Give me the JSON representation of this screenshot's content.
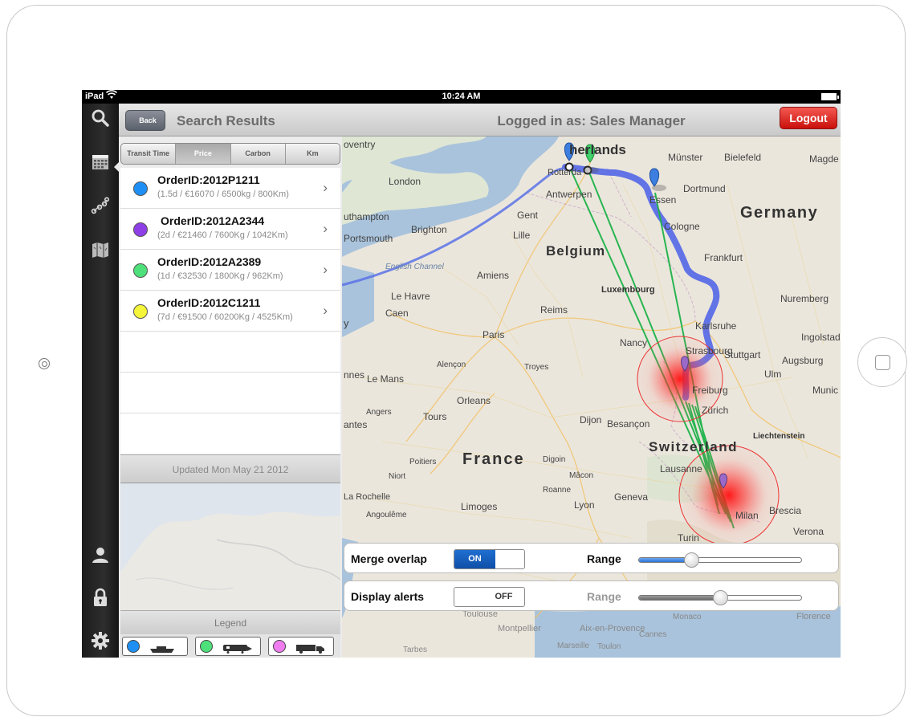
{
  "status_bar": {
    "carrier": "iPad",
    "time": "10:24 AM"
  },
  "toolbar": {
    "icons": [
      "search-icon",
      "calendar-icon",
      "route-icon",
      "map-icon",
      "user-icon",
      "lock-icon",
      "gear-icon"
    ]
  },
  "left_panel": {
    "back_label": "Back",
    "title": "Search Results",
    "segments": [
      {
        "label": "Transit Time",
        "active": false
      },
      {
        "label": "Price",
        "active": true
      },
      {
        "label": "Carbon",
        "active": false
      },
      {
        "label": "Km",
        "active": false
      }
    ],
    "orders": [
      {
        "id": "OrderID:2012P1211",
        "details": "(1.5d / €16070 / 6500kg / 800Km)",
        "color": "#1e90f5"
      },
      {
        "id": "OrderID:2012A2344",
        "details": "(2d / €21460 / 7600Kg / 1042Km)",
        "color": "#8e3fe6"
      },
      {
        "id": "OrderID:2012A2389",
        "details": "(1d / €32530 / 1800Kg / 962Km)",
        "color": "#4ee07a"
      },
      {
        "id": "OrderID:2012C1211",
        "details": "(7d / €91500 / 60200Kg / 4525Km)",
        "color": "#f5f53a"
      }
    ],
    "updated": "Updated Mon May 21 2012",
    "legend_title": "Legend",
    "legend": [
      {
        "color": "#1e90f5",
        "vehicle": "ship-icon"
      },
      {
        "color": "#4ee07a",
        "vehicle": "train-icon"
      },
      {
        "color": "#f07df0",
        "vehicle": "truck-icon"
      }
    ]
  },
  "map_header": {
    "title": "Logged in as: Sales Manager",
    "logout": "Logout"
  },
  "map_labels": {
    "country_germany": "Germany",
    "country_belgium": "Belgium",
    "country_france": "France",
    "country_switzerland": "Switzerland",
    "country_netherlands": "herlands",
    "london": "London",
    "rotterdam": "Rotterda",
    "antwerpen": "Antwerpen",
    "gent": "Gent",
    "lille": "Lille",
    "brighton": "Brighton",
    "portsmouth": "Portsmouth",
    "southampton": "uthampton",
    "english_channel": "English Channel",
    "amiens": "Amiens",
    "le_havre": "Le Havre",
    "caen": "Caen",
    "reims": "Reims",
    "paris": "Paris",
    "luxembourg": "Luxembourg",
    "nancy": "Nancy",
    "strasbourg": "Strasbourg",
    "karlsruhe": "Karlsruhe",
    "stuttgart": "Stuttgart",
    "frankfurt": "Frankfurt",
    "cologne": "Cologne",
    "essen": "Essen",
    "dortmund": "Dortmund",
    "munster": "Münster",
    "bielefeld": "Bielefeld",
    "magdeburg": "Magde",
    "nuremberg": "Nuremberg",
    "ingolstadt": "Ingolstad",
    "augsburg": "Augsburg",
    "ulm": "Ulm",
    "munich": "Munic",
    "freiburg": "Freiburg",
    "zurich": "Zürich",
    "lichtenstein": "Liechtenstein",
    "le_mans": "Le Mans",
    "alencon": "Alençon",
    "troyes": "Troyes",
    "orleans": "Orleans",
    "tours": "Tours",
    "angers": "Angers",
    "nantes": "antes",
    "rennes": "nnes",
    "dijon": "Dijon",
    "besancon": "Besançon",
    "poitiers": "Poitiers",
    "niort": "Niort",
    "la_rochelle": "La Rochelle",
    "angouleme": "Angoulême",
    "limoges": "Limoges",
    "digoin": "Digoin",
    "macon": "Mâcon",
    "roanne": "Roanne",
    "lyon": "Lyon",
    "geneva": "Geneva",
    "lausanne": "Lausanne",
    "turin": "Turin",
    "milan": "Milan",
    "brescia": "Brescia",
    "verona": "Verona",
    "toulouse": "Toulouse",
    "montpellier": "Montpellier",
    "aix": "Aix-en-Provence",
    "marseille": "Marseille",
    "toulon": "Toulon",
    "cannes": "Cannes",
    "monaco": "Monaco",
    "florence": "Florence",
    "tarbes": "Tarbes",
    "coventry": "oventry",
    "y_edge": "y"
  },
  "controls": {
    "merge_label": "Merge overlap",
    "merge_state": "ON",
    "merge_range_label": "Range",
    "merge_range_value": 0.32,
    "alerts_label": "Display alerts",
    "alerts_state": "OFF",
    "alerts_range_label": "Range",
    "alerts_range_value": 0.5
  },
  "colors": {
    "route_blue": "#4a5ee8",
    "route_green": "#19b34a",
    "alert_red": "#ff1a1a",
    "logout_red": "#d41a14",
    "toggle_blue": "#1565c8"
  }
}
